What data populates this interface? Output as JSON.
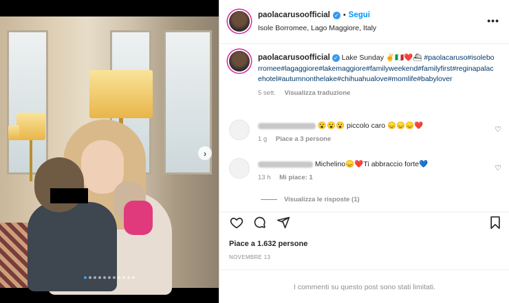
{
  "post": {
    "username": "paolacarusoofficial",
    "follow_label": "Segui",
    "separator": "•",
    "location": "Isole Borromee, Lago Maggiore, Italy",
    "more_label": "•••",
    "next_label": "›"
  },
  "caption": {
    "username": "paolacarusoofficial",
    "text": "Lake Sunday ✌️🇮🇹❤️⛴",
    "hashtags": "#paolacaruso#isoleborromee#lagaggiore#lakemaggiore#familyweekend#familyfirst#reginapalacehotel#autumnonthelake#chihuahualove#momlife#babylover",
    "age": "5 sett.",
    "translate_label": "Visualizza traduzione"
  },
  "comments": [
    {
      "text": "😮😮😮 piccolo caro 😞😞😞❤️",
      "age": "1 g",
      "likes": "Piace a 3 persone"
    },
    {
      "text": "Michelino😞❤️Ti abbraccio forte💙",
      "age": "13 h",
      "likes": "Mi piace: 1"
    }
  ],
  "replies_label": "Visualizza le risposte (1)",
  "likes_text": "Piace a 1.632 persone",
  "date_text": "NOVEMBRE 13",
  "comments_limited": "I commenti su questo post sono stati limitati.",
  "carousel": {
    "count": 11,
    "active_index": 0
  },
  "colors": {
    "accent": "#0095f6",
    "hashtag": "#00376b",
    "muted": "#8e8e8e"
  }
}
